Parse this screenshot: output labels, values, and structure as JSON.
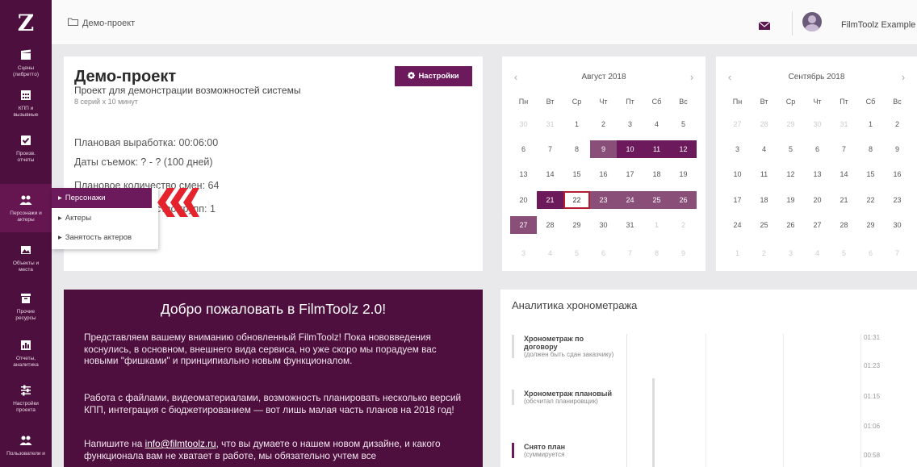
{
  "app": {
    "logo": "Z"
  },
  "sidebar": {
    "items": [
      {
        "icon": "clapperboard-icon",
        "label": "Сцены\n(либретто)"
      },
      {
        "icon": "calendar-grid-icon",
        "label": "КПП и\nвызывные"
      },
      {
        "icon": "check-square-icon",
        "label": "Произв.\nотчеты"
      },
      {
        "icon": "people-icon",
        "label": "Персонажи и\nактеры"
      },
      {
        "icon": "image-icon",
        "label": "Объекты и\nместа"
      },
      {
        "icon": "box-icon",
        "label": "Прочие\nресурсы"
      },
      {
        "icon": "bar-chart-icon",
        "label": "Отчеты,\nаналитика"
      },
      {
        "icon": "sliders-icon",
        "label": "Настройки\nпроекта"
      },
      {
        "icon": "users-icon",
        "label": "Пользователи и"
      }
    ]
  },
  "header": {
    "breadcrumb": "Демо-проект",
    "user_name": "FilmToolz Example"
  },
  "project": {
    "title": "Демо-проект",
    "subtitle": "Проект для демонстрации возможностей системы",
    "meta": "8 серий х 10 минут",
    "settings_label": "Настройки",
    "stats": [
      "Плановая выработка: 00:06:00",
      "Даты съемок: ? - ? (100 дней)",
      "Плановое количество смен: 64",
      "Плановое количество групп: 1"
    ]
  },
  "menu": {
    "items": [
      "Персонажи",
      "Актеры",
      "Занятость актеров"
    ]
  },
  "calendar_aug": {
    "title": "Август 2018",
    "weekdays": [
      "Пн",
      "Вт",
      "Ср",
      "Чт",
      "Пт",
      "Сб",
      "Вс"
    ],
    "rows": [
      [
        "30",
        "31",
        "1",
        "2",
        "3",
        "4",
        "5"
      ],
      [
        "6",
        "7",
        "8",
        "9",
        "10",
        "11",
        "12"
      ],
      [
        "13",
        "14",
        "15",
        "16",
        "17",
        "18",
        "19"
      ],
      [
        "20",
        "21",
        "22",
        "23",
        "24",
        "25",
        "26"
      ],
      [
        "27",
        "28",
        "29",
        "30",
        "31",
        "1",
        "2"
      ],
      [
        "3",
        "4",
        "5",
        "6",
        "7",
        "8",
        "9"
      ]
    ]
  },
  "calendar_sep": {
    "title": "Сентябрь 2018",
    "weekdays": [
      "Пн",
      "Вт",
      "Ср",
      "Чт",
      "Пт",
      "Сб",
      "Вс"
    ],
    "rows": [
      [
        "27",
        "28",
        "29",
        "30",
        "31",
        "1",
        "2"
      ],
      [
        "3",
        "4",
        "5",
        "6",
        "7",
        "8",
        "9"
      ],
      [
        "10",
        "11",
        "12",
        "13",
        "14",
        "15",
        "16"
      ],
      [
        "17",
        "18",
        "19",
        "20",
        "21",
        "22",
        "23"
      ],
      [
        "24",
        "25",
        "26",
        "27",
        "28",
        "29",
        "30"
      ],
      [
        "1",
        "2",
        "3",
        "4",
        "5",
        "6",
        "7"
      ]
    ]
  },
  "welcome": {
    "title": "Добро пожаловать в FilmToolz 2.0!",
    "p1": "Представляем вашему вниманию обновленный FilmToolz! Пока нововведения коснулись, в основном, внешнего вида сервиса, но уже скоро мы порадуем вас новыми \"фишками\" и принципиально новым функционалом.",
    "p2": "Работа с файлами, видеоматериалами, возможность планировать несколько версий КПП, интеграция с бюджетированием — вот лишь малая часть планов на 2018 год!",
    "p3_before": "Напишите на ",
    "p3_link": "info@filmtoolz.ru",
    "p3_after": ", что вы думаете о нашем новом дизайне, и какого функционала вам не хватает в работе, мы обязательно учтем все"
  },
  "analytics": {
    "title": "Аналитика хронометража",
    "legend": [
      {
        "title": "Хронометраж по договору",
        "desc": "(должен быть сдан заказчику)"
      },
      {
        "title": "Хронометраж плановый",
        "desc": "(обсчитал планировщик)"
      },
      {
        "title": "Снято план",
        "desc": "(суммируется"
      }
    ],
    "yticks": [
      "01:31",
      "01:23",
      "01:15",
      "01:06",
      "00:58"
    ]
  }
}
